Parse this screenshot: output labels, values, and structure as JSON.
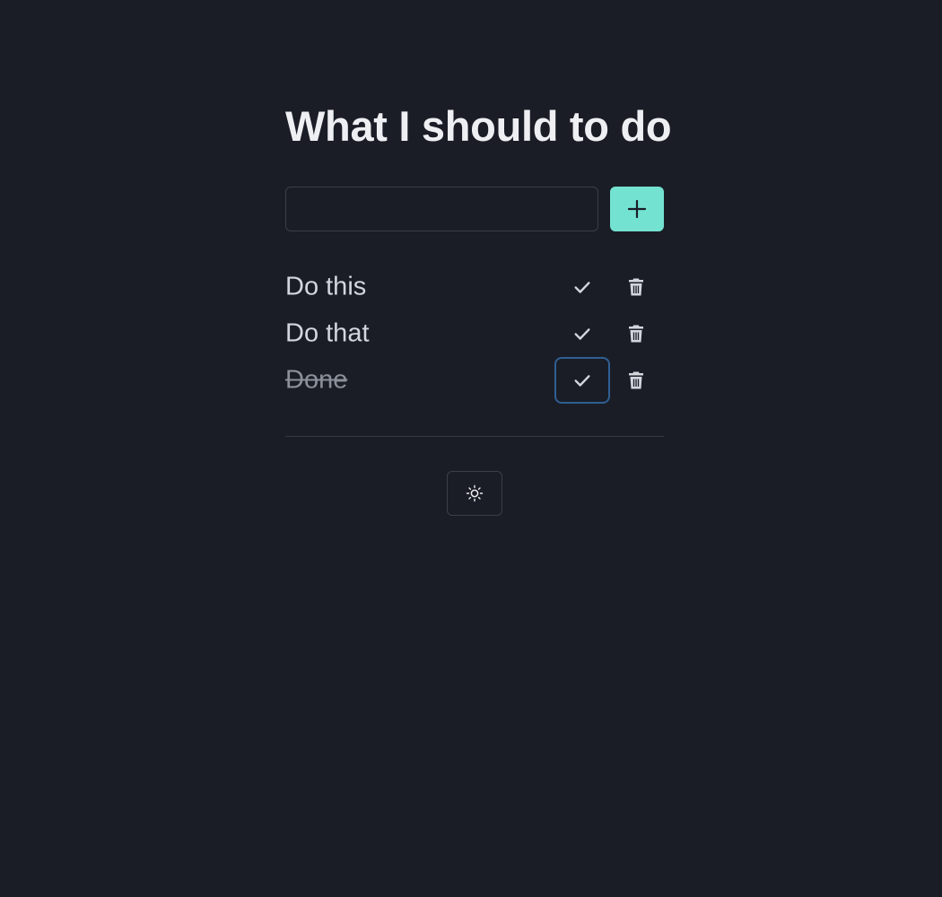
{
  "header": {
    "title": "What I should to do"
  },
  "new_task": {
    "value": "",
    "placeholder": "",
    "add_icon": "plus-icon"
  },
  "tasks": [
    {
      "label": "Do this",
      "done": false,
      "complete_icon": "check-icon",
      "delete_icon": "trash-icon"
    },
    {
      "label": "Do that",
      "done": false,
      "complete_icon": "check-icon",
      "delete_icon": "trash-icon"
    },
    {
      "label": "Done",
      "done": true,
      "focused": true,
      "complete_icon": "check-icon",
      "delete_icon": "trash-icon"
    }
  ],
  "footer": {
    "theme_icon": "sun-icon"
  },
  "colors": {
    "background": "#1a1d26",
    "accent": "#74e2d1",
    "focus_ring": "#2f5f93",
    "text": "#eeeff2",
    "muted_text": "#8b909a"
  }
}
